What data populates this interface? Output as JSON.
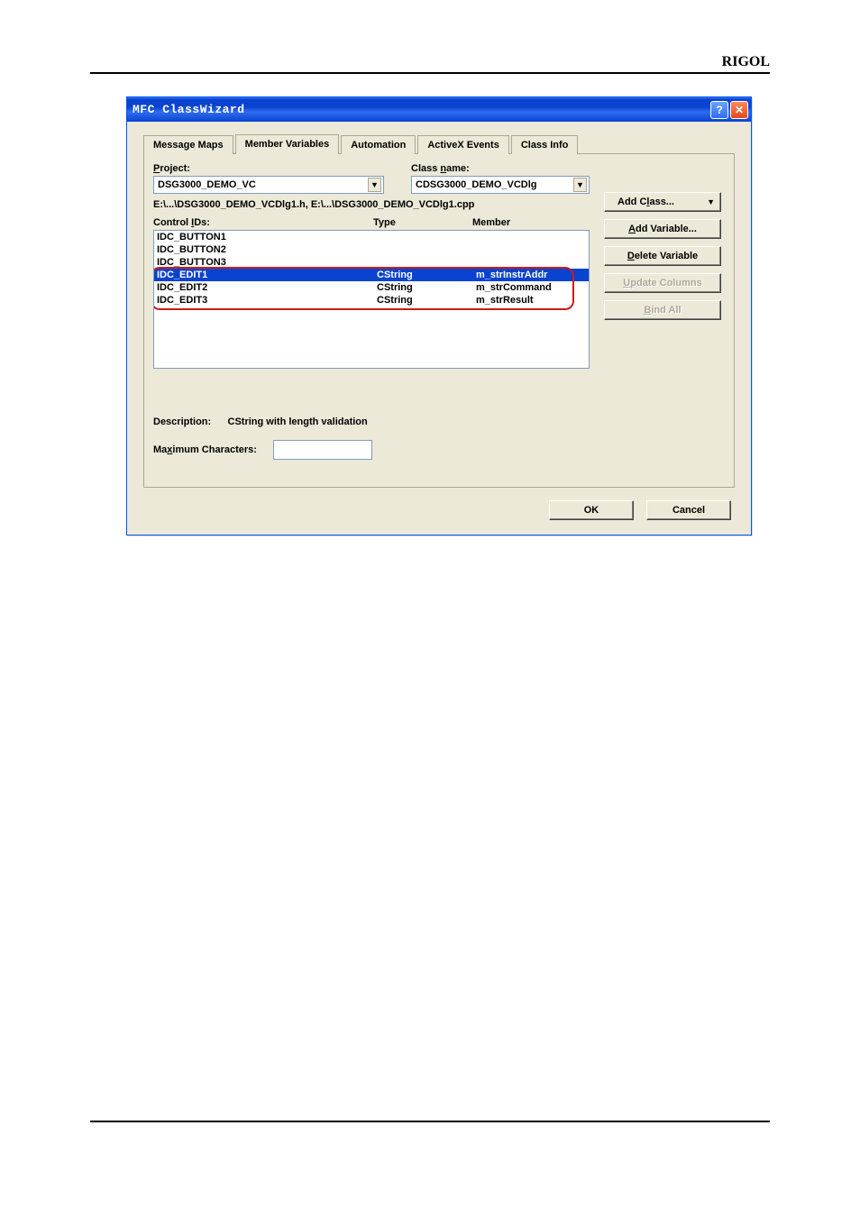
{
  "page_brand": "RIGOL",
  "window": {
    "title": "MFC ClassWizard",
    "help_icon": "?",
    "close_icon": "✕"
  },
  "tabs": [
    {
      "label": "Message Maps",
      "active": false
    },
    {
      "label": "Member Variables",
      "active": true
    },
    {
      "label": "Automation",
      "active": false
    },
    {
      "label": "ActiveX Events",
      "active": false
    },
    {
      "label": "Class Info",
      "active": false
    }
  ],
  "form": {
    "project_label": "Project:",
    "project_value": "DSG3000_DEMO_VC",
    "classname_label": "Class name:",
    "classname_value": "CDSG3000_DEMO_VCDlg",
    "file_path": "E:\\...\\DSG3000_DEMO_VCDlg1.h, E:\\...\\DSG3000_DEMO_VCDlg1.cpp",
    "control_ids_label": "Control IDs:",
    "headers": {
      "id": "",
      "type": "Type",
      "member": "Member"
    },
    "rows": [
      {
        "id": "IDC_BUTTON1",
        "type": "",
        "member": "",
        "selected": false
      },
      {
        "id": "IDC_BUTTON2",
        "type": "",
        "member": "",
        "selected": false
      },
      {
        "id": "IDC_BUTTON3",
        "type": "",
        "member": "",
        "selected": false
      },
      {
        "id": "IDC_EDIT1",
        "type": "CString",
        "member": "m_strInstrAddr",
        "selected": true
      },
      {
        "id": "IDC_EDIT2",
        "type": "CString",
        "member": "m_strCommand",
        "selected": false
      },
      {
        "id": "IDC_EDIT3",
        "type": "CString",
        "member": "m_strResult",
        "selected": false
      }
    ],
    "description_label": "Description:",
    "description_value": "CString with length validation",
    "maxchar_label": "Maximum Characters:",
    "maxchar_value": ""
  },
  "side_buttons": {
    "add_class": "Add Class...",
    "add_variable": "Add Variable...",
    "delete_variable": "Delete Variable",
    "update_columns": "Update Columns",
    "bind_all": "Bind All"
  },
  "bottom_buttons": {
    "ok": "OK",
    "cancel": "Cancel"
  }
}
